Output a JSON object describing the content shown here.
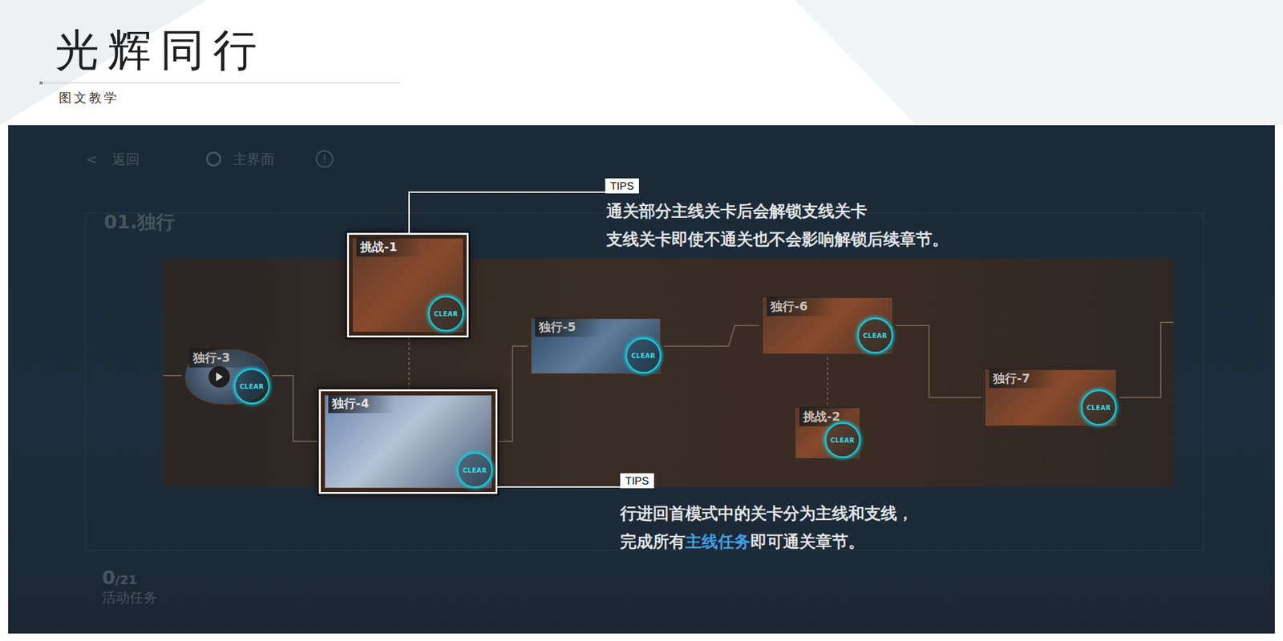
{
  "title": "光辉同行",
  "subtitle": "图文教学",
  "game_ui": {
    "back_icon": "<",
    "back": "返回",
    "home": "主界面",
    "info": "!",
    "chapter": "01.独行",
    "task_count": "0",
    "task_total": "/21",
    "task_label": "活动任务"
  },
  "nodes": [
    {
      "label": "挑战-1",
      "badge": "CLEAR",
      "highlighted": true,
      "kind": "stage"
    },
    {
      "label": "独行-3",
      "badge": "CLEAR",
      "highlighted": false,
      "kind": "video"
    },
    {
      "label": "独行-4",
      "badge": "CLEAR",
      "highlighted": true,
      "kind": "stage"
    },
    {
      "label": "独行-5",
      "badge": "CLEAR",
      "highlighted": false,
      "kind": "stage"
    },
    {
      "label": "独行-6",
      "badge": "CLEAR",
      "highlighted": false,
      "kind": "stage"
    },
    {
      "label": "挑战-2",
      "badge": "CLEAR",
      "highlighted": false,
      "kind": "stage"
    },
    {
      "label": "独行-7",
      "badge": "CLEAR",
      "highlighted": false,
      "kind": "stage"
    }
  ],
  "tips": [
    {
      "tag": "TIPS",
      "lines": [
        [
          {
            "text": "通关部分主线关卡后会解锁支线关卡",
            "accent": false
          }
        ],
        [
          {
            "text": "支线关卡即使不通关也不会影响解锁后续章节。",
            "accent": false
          }
        ]
      ]
    },
    {
      "tag": "TIPS",
      "lines": [
        [
          {
            "text": "行进回首模式中的关卡分为主线和支线，",
            "accent": false
          }
        ],
        [
          {
            "text": "完成所有",
            "accent": false
          },
          {
            "text": "主线任务",
            "accent": true
          },
          {
            "text": "即可通关章节。",
            "accent": false
          }
        ]
      ]
    }
  ]
}
